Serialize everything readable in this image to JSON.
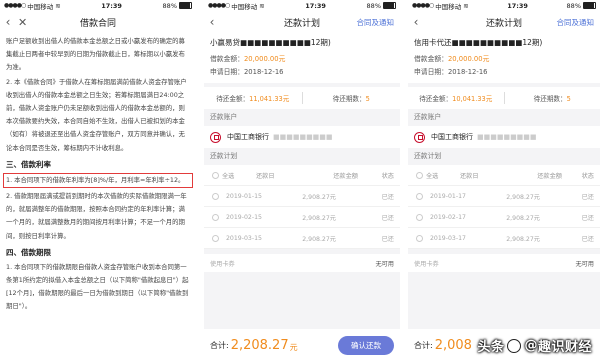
{
  "status_bars": [
    {
      "carrier": "中国移动",
      "wifi": "WiFi",
      "time": "17:39",
      "battery": "88%"
    },
    {
      "carrier": "中国移动",
      "wifi": "WiFi",
      "time": "17:39",
      "battery": "88%"
    },
    {
      "carrier": "中国移动",
      "wifi": "WiFi",
      "time": "17:39",
      "battery": "88%"
    }
  ],
  "contract": {
    "title": "借款合同",
    "para1": "账户足额收到出借人的借款本金总额之日或小赢发布的确定的募集截止日两者中较早到的日期为借款截止日，筹标期以小赢发布为准。",
    "para2": "2. 本《借款合同》于借款人在筹标期届满前借款人资金存管账户收到出借人的借款本金总额之日生效；若筹标期届满日24:00之前，借款人资金账户仍未足额收到出借人的借款本金总额的，则本次借款要约失效，本合同自始不生效，出借人已被扣划的本金（如有）将被退还至出借人资金存管账户，双方同意并确认，无论本合同是否生效，筹标期内不计收利息。",
    "section3": "三、借款利率",
    "rate_highlight": "1. 本合同项下的借款年利率为[8]%/年，月利率=年利率÷12。",
    "para3": "2. 借款期限届满或提前到期时的本次借款的实际借款期限满一年的，就届满整年的借款期限，按照本合同约定的年利率计算；满一个月的，就届满整数月的期间按月利率计算；不足一个月的期间，则按日利率计算。",
    "section4": "四、借款期限",
    "para4": "1. 本合同项下的借款期限自借款人资金存管账户收到本合同第一条第1所约定的拟借入本金总额之日（以下简称\"借款起息日\"）起[12个月]，借款期限的最后一日为借款到期日（以下简称\"借款到期日\"）。"
  },
  "plans": [
    {
      "title": "还款计划",
      "nav_right": "合同及通知",
      "loan_name": "小赢易贷■■■■■■■■■■12期)",
      "amount_label": "借款金额：",
      "amount_value": "20,000.00元",
      "date_label": "申请日期：",
      "date_value": "2018-12-16",
      "pending_amount_label": "待还金额：",
      "pending_amount_value": "11,041.33元",
      "pending_count_label": "待还期数：",
      "pending_count_value": "5",
      "account_section": "还款账户",
      "bank_name": "中国工商银行",
      "bank_masked": "■■■■■■■■■",
      "schedule_section": "还款计划",
      "headers": {
        "select_all": "全选",
        "date": "还款日",
        "amount": "还款金额",
        "status": "状态"
      },
      "rows": [
        {
          "date": "2019-01-15",
          "amount": "2,908.27元",
          "status": "已还"
        },
        {
          "date": "2019-02-15",
          "amount": "2,908.27元",
          "status": "已还"
        },
        {
          "date": "2019-03-15",
          "amount": "2,908.27元",
          "status": "已还"
        }
      ],
      "coupon_label": "使用卡券",
      "coupon_value": "无可用",
      "total_label": "合计:",
      "total_value": "2,208.27",
      "total_unit": "元",
      "confirm_button": "确认还款"
    },
    {
      "title": "还款计划",
      "nav_right": "合同及通知",
      "loan_name": "信用卡代还■■■■■■■■■■12期)",
      "amount_label": "借款金额：",
      "amount_value": "20,000.00元",
      "date_label": "申请日期：",
      "date_value": "2018-12-16",
      "pending_amount_label": "待还金额：",
      "pending_amount_value": "10,041.33元",
      "pending_count_label": "待还期数：",
      "pending_count_value": "5",
      "account_section": "还款账户",
      "bank_name": "中国工商银行",
      "bank_masked": "■■■■■■■■■",
      "schedule_section": "还款计划",
      "headers": {
        "select_all": "全选",
        "date": "还款日",
        "amount": "还款金额",
        "status": "状态"
      },
      "rows": [
        {
          "date": "2019-01-17",
          "amount": "2,908.27元",
          "status": "已还"
        },
        {
          "date": "2019-02-17",
          "amount": "2,908.27元",
          "status": "已还"
        },
        {
          "date": "2019-03-17",
          "amount": "2,908.27元",
          "status": "已还"
        }
      ],
      "coupon_label": "使用卡券",
      "coupon_value": "无可用",
      "total_label": "合计:",
      "total_value": "2,008",
      "total_unit": "",
      "confirm_button": ""
    }
  ],
  "watermark": {
    "prefix": "头条",
    "at": "@",
    "name": "趣识财经"
  },
  "icons": {
    "back": "chevron-left-icon",
    "close": "close-icon",
    "bank": "icbc-logo-icon"
  },
  "colors": {
    "accent": "#6a7ad8",
    "amount": "#f08c1e",
    "link": "#4a6fd6",
    "highlight_box": "#e23b3b"
  }
}
